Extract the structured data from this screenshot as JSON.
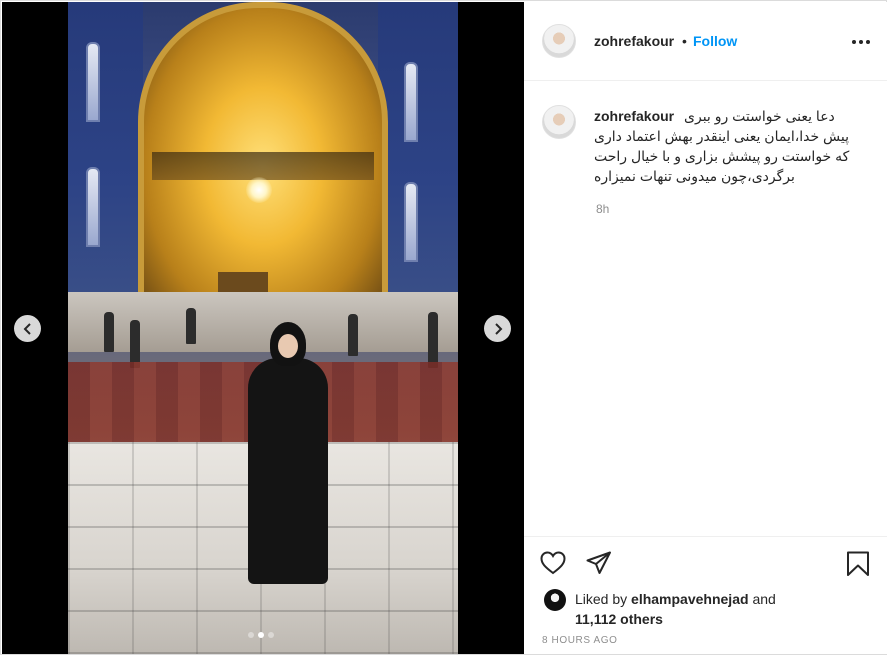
{
  "post": {
    "username": "zohrefakour",
    "follow_label": "Follow",
    "separator": "•",
    "caption": "دعا یعنی خواستت رو ببری پیش خدا،ایمان یعنی اینقدر بهش اعتماد داری که خواستت رو پیشش بزاری و با خیال راحت برگردی،چون میدونی تنهات نمیزاره",
    "caption_time": "8h",
    "liked_by_prefix": "Liked by",
    "liked_by_user": "elhampavehnejad",
    "liked_by_and": "and",
    "others_count": "11,112 others",
    "post_time": "8 HOURS AGO"
  },
  "carousel": {
    "prev_icon": "chevron-left-icon",
    "next_icon": "chevron-right-icon",
    "total_slides": 3,
    "active_slide": 2
  },
  "colors": {
    "link_blue": "#0095f6",
    "text": "#262626",
    "muted": "#8e8e8e",
    "border": "#efefef"
  }
}
